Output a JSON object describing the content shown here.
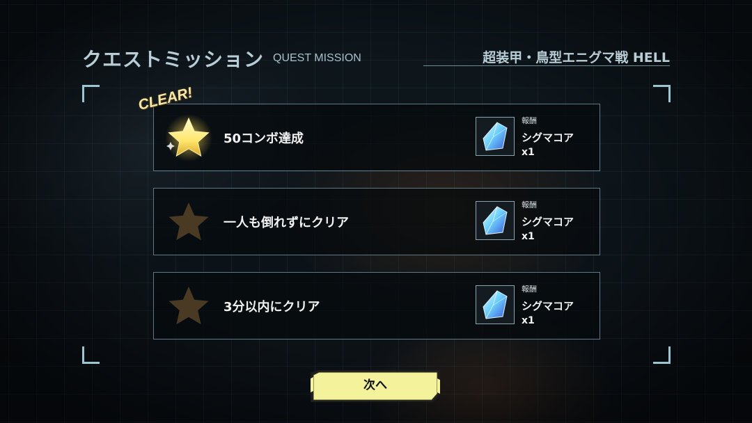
{
  "header": {
    "title_jp": "クエストミッション",
    "title_en": "QUEST MISSION",
    "stage_name": "超装甲・鳥型エニグマ戦 HELL"
  },
  "missions": [
    {
      "text": "50コンボ達成",
      "cleared": true,
      "clear_label": "CLEAR!",
      "reward_label": "報酬",
      "reward_name": "シグマコア",
      "reward_qty": "x1",
      "reward_icon": "crystal-icon"
    },
    {
      "text": "一人も倒れずにクリア",
      "cleared": false,
      "reward_label": "報酬",
      "reward_name": "シグマコア",
      "reward_qty": "x1",
      "reward_icon": "crystal-icon"
    },
    {
      "text": "3分以内にクリア",
      "cleared": false,
      "reward_label": "報酬",
      "reward_name": "シグマコア",
      "reward_qty": "x1",
      "reward_icon": "crystal-icon"
    }
  ],
  "next_button": {
    "label": "次へ"
  },
  "colors": {
    "star_cleared": "#ffe66a",
    "star_uncleared": "#4a3a24",
    "panel_border": "#5f7883",
    "accent_frame": "#9ec6d2",
    "button_fill": "#f4f29a",
    "button_border": "#1e1e1e"
  }
}
